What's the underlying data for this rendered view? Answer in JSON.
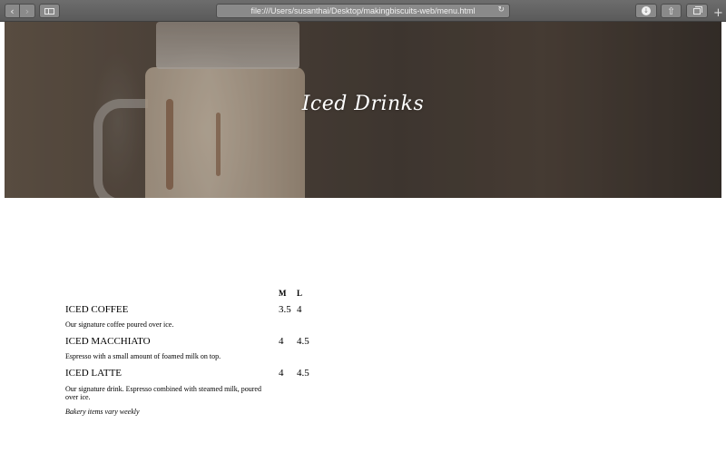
{
  "browser": {
    "url": "file:///Users/susanthai/Desktop/makingbiscuits-web/menu.html",
    "icons": {
      "back": "chevron-left-icon",
      "forward": "chevron-right-icon",
      "sidebar": "sidebar-icon",
      "reload": "reload-icon",
      "download": "download-icon",
      "share": "share-icon",
      "tabs": "tabs-icon",
      "new_tab": "plus-icon"
    }
  },
  "hero": {
    "title": "Iced Drinks"
  },
  "menu": {
    "size_headers": {
      "m": "M",
      "l": "L"
    },
    "items": [
      {
        "name": "ICED COFFEE",
        "price_m": "3.5",
        "price_l": "4",
        "description": "Our signature coffee poured over ice."
      },
      {
        "name": "ICED MACCHIATO",
        "price_m": "4",
        "price_l": "4.5",
        "description": "Espresso with a small amount of foamed milk on top."
      },
      {
        "name": "ICED LATTE",
        "price_m": "4",
        "price_l": "4.5",
        "description": "Our signature drink. Espresso combined with steamed milk, poured over ice."
      }
    ],
    "note": "Bakery items vary weekly"
  }
}
